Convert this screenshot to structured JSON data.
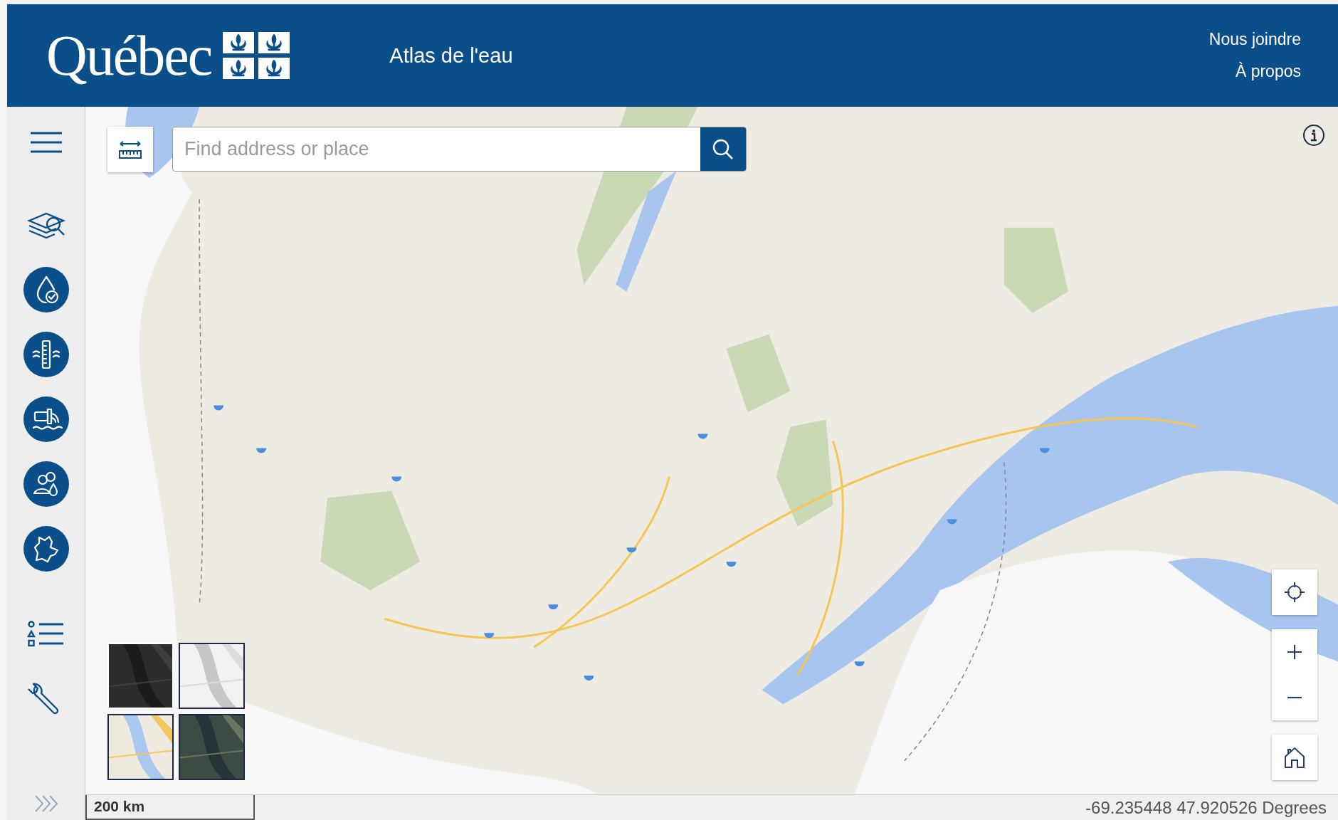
{
  "header": {
    "logo": "Québec",
    "title": "Atlas de l'eau",
    "links": [
      "Nous joindre",
      "À propos"
    ]
  },
  "search": {
    "placeholder": "Find address or place"
  },
  "status_bar": {
    "scale": "200 km",
    "coordinates": "-69.235448 47.920526 Degrees"
  }
}
